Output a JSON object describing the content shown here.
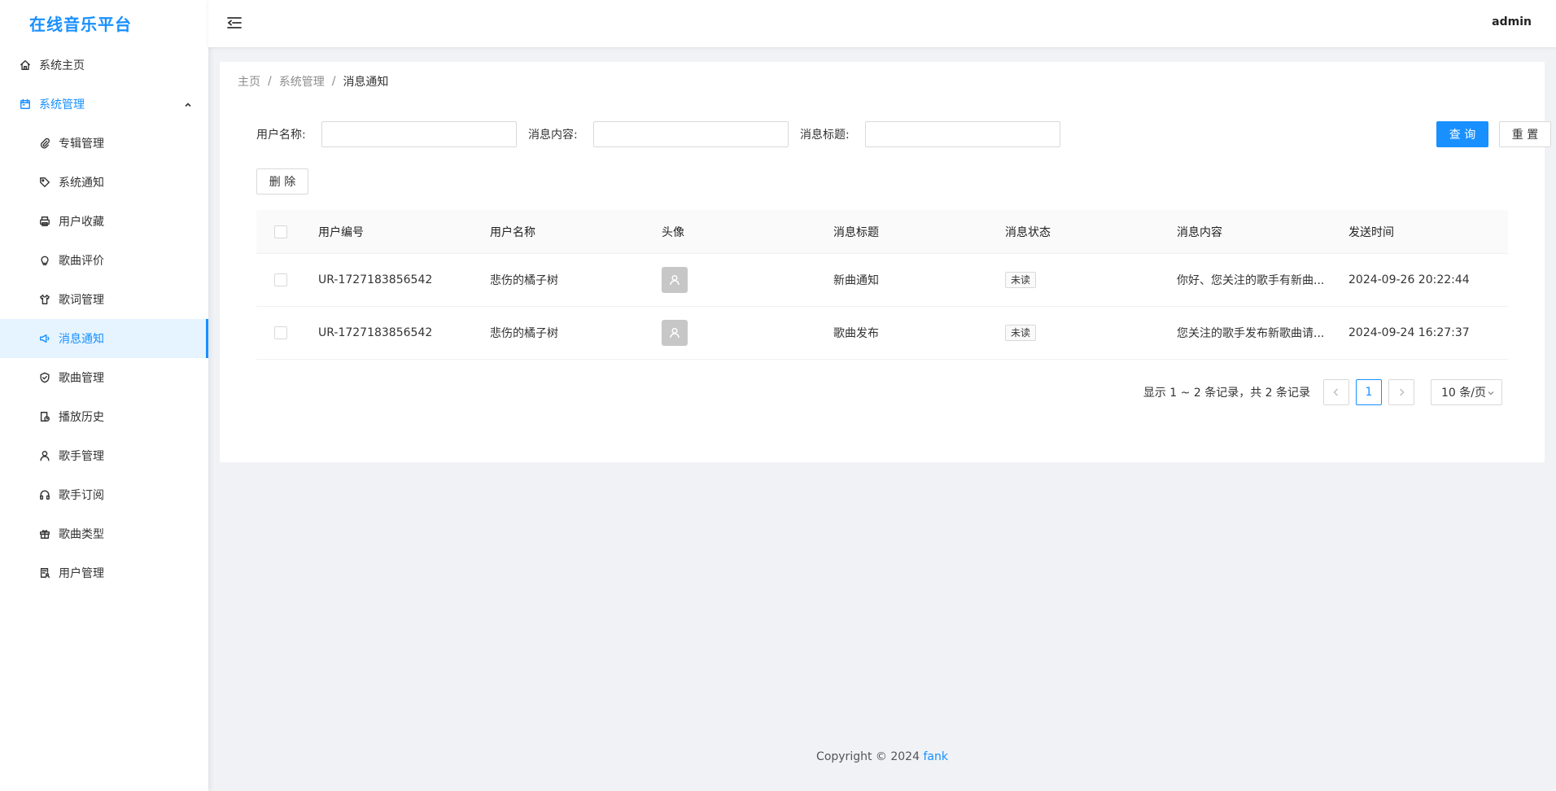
{
  "app": {
    "title": "在线音乐平台",
    "user": "admin"
  },
  "sidebar": {
    "home": "系统主页",
    "group": "系统管理",
    "items": [
      {
        "label": "专辑管理",
        "icon": "paperclip-icon"
      },
      {
        "label": "系统通知",
        "icon": "tag-icon"
      },
      {
        "label": "用户收藏",
        "icon": "printer-icon"
      },
      {
        "label": "歌曲评价",
        "icon": "bulb-icon"
      },
      {
        "label": "歌词管理",
        "icon": "shirt-icon"
      },
      {
        "label": "消息通知",
        "icon": "megaphone-icon",
        "active": true
      },
      {
        "label": "歌曲管理",
        "icon": "shield-icon"
      },
      {
        "label": "播放历史",
        "icon": "history-icon"
      },
      {
        "label": "歌手管理",
        "icon": "user-icon"
      },
      {
        "label": "歌手订阅",
        "icon": "headphones-icon"
      },
      {
        "label": "歌曲类型",
        "icon": "gift-icon"
      },
      {
        "label": "用户管理",
        "icon": "user-file-icon"
      }
    ]
  },
  "breadcrumb": {
    "home": "主页",
    "section": "系统管理",
    "current": "消息通知",
    "sep": "/"
  },
  "search": {
    "user_name_label": "用户名称:",
    "content_label": "消息内容:",
    "title_label": "消息标题:",
    "user_name_value": "",
    "content_value": "",
    "title_value": "",
    "query_btn": "查 询",
    "reset_btn": "重 置",
    "delete_btn": "删 除"
  },
  "table": {
    "columns": [
      "用户编号",
      "用户名称",
      "头像",
      "消息标题",
      "消息状态",
      "消息内容",
      "发送时间"
    ],
    "rows": [
      {
        "user_id": "UR-1727183856542",
        "user_name": "悲伤的橘子树",
        "title": "新曲通知",
        "status": "未读",
        "content": "你好、您关注的歌手有新曲...",
        "time": "2024-09-26 20:22:44"
      },
      {
        "user_id": "UR-1727183856542",
        "user_name": "悲伤的橘子树",
        "title": "歌曲发布",
        "status": "未读",
        "content": "您关注的歌手发布新歌曲请...",
        "time": "2024-09-24 16:27:37"
      }
    ]
  },
  "pagination": {
    "total_text": "显示 1 ~ 2 条记录，共 2 条记录",
    "current": "1",
    "page_size": "10 条/页"
  },
  "footer": {
    "copyright": "Copyright © 2024",
    "author": "fank"
  },
  "colors": {
    "primary": "#1890ff",
    "sidebar_active_bg": "#e6f4ff",
    "page_bg": "#f0f2f5"
  }
}
